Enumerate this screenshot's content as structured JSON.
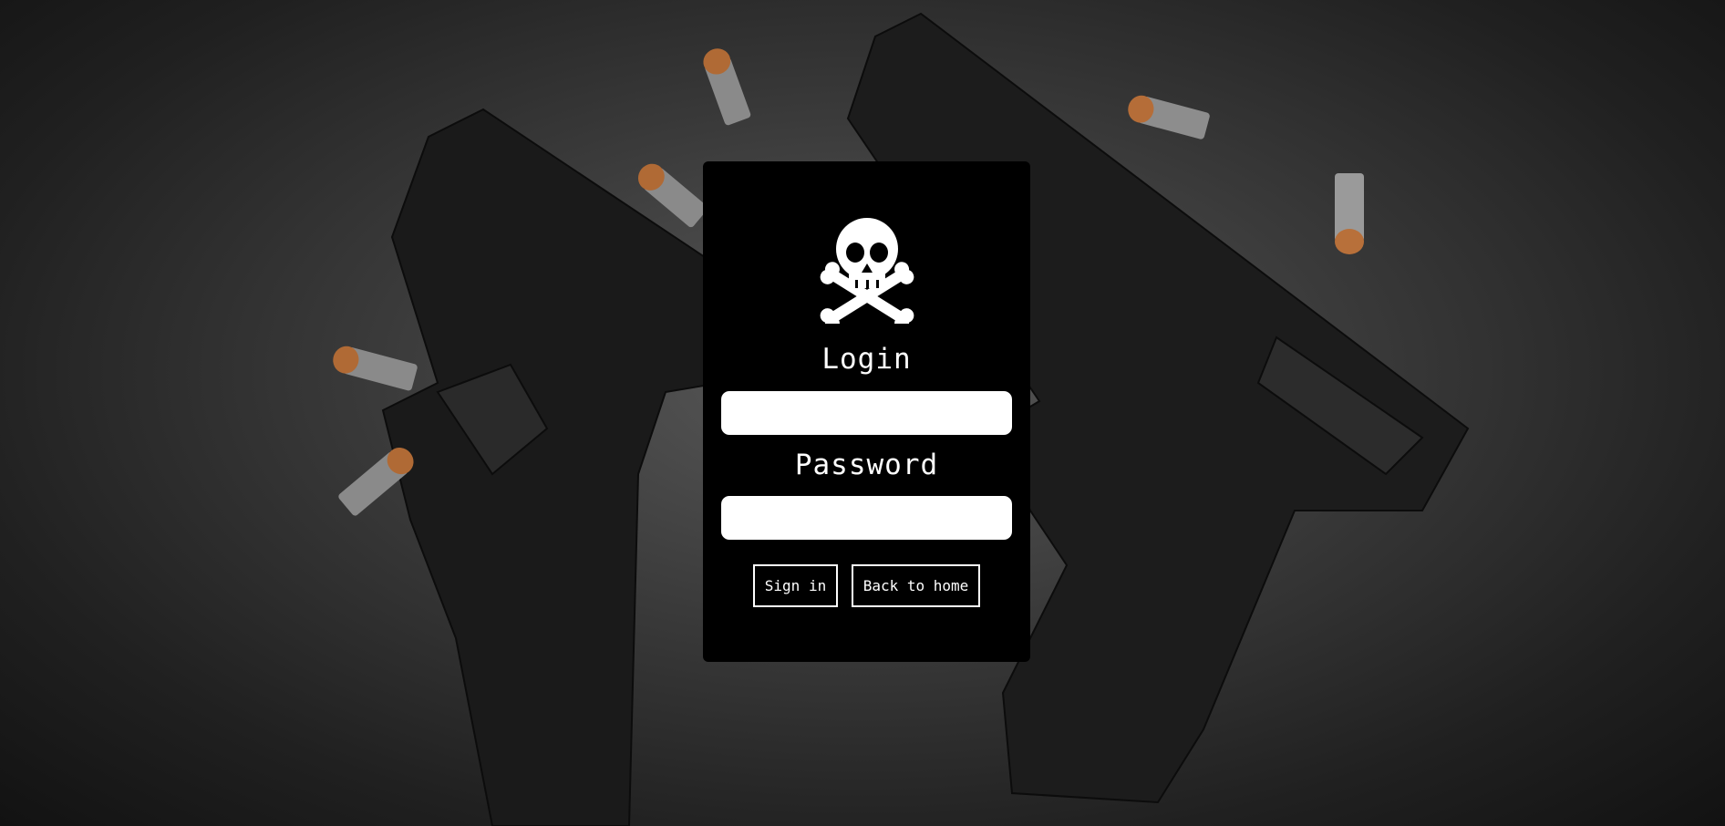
{
  "form": {
    "login_label": "Login",
    "login_value": "",
    "password_label": "Password",
    "password_value": "",
    "signin_label": "Sign in",
    "home_label": "Back to home"
  },
  "icons": {
    "card_icon": "skull-crossbones-icon"
  },
  "colors": {
    "card_bg": "#000000",
    "text": "#ffffff",
    "field_bg": "#ffffff",
    "page_bg": "#3a3a3a"
  }
}
